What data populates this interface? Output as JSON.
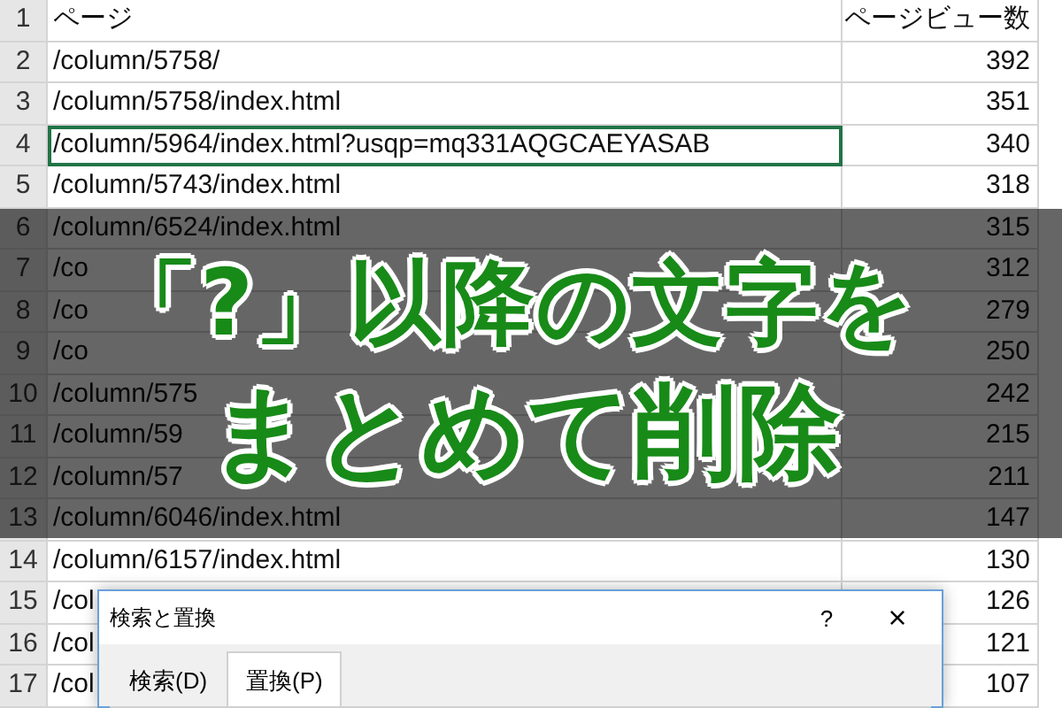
{
  "sheet": {
    "rows": [
      {
        "number": "1",
        "page": "ページ",
        "views": "ページビュー数",
        "selected": false
      },
      {
        "number": "2",
        "page": "/column/5758/",
        "views": "392",
        "selected": false
      },
      {
        "number": "3",
        "page": "/column/5758/index.html",
        "views": "351",
        "selected": false
      },
      {
        "number": "4",
        "page": "/column/5964/index.html?usqp=mq331AQGCAEYASAB",
        "views": "340",
        "selected": true
      },
      {
        "number": "5",
        "page": "/column/5743/index.html",
        "views": "318",
        "selected": false
      },
      {
        "number": "6",
        "page": "/column/6524/index.html",
        "views": "315",
        "selected": false
      },
      {
        "number": "7",
        "page": "/co",
        "views": "312",
        "selected": false
      },
      {
        "number": "8",
        "page": "/co",
        "views": "279",
        "selected": false
      },
      {
        "number": "9",
        "page": "/co",
        "views": "250",
        "selected": false
      },
      {
        "number": "10",
        "page": "/column/575",
        "views": "242",
        "selected": false
      },
      {
        "number": "11",
        "page": "/column/59",
        "views": "215",
        "selected": false
      },
      {
        "number": "12",
        "page": "/column/57",
        "views": "211",
        "selected": false
      },
      {
        "number": "13",
        "page": "/column/6046/index.html",
        "views": "147",
        "selected": false
      },
      {
        "number": "14",
        "page": "/column/6157/index.html",
        "views": "130",
        "selected": false
      },
      {
        "number": "15",
        "page": "/col",
        "views": "126",
        "selected": false
      },
      {
        "number": "16",
        "page": "/col",
        "views": "121",
        "selected": false
      },
      {
        "number": "17",
        "page": "/col",
        "views": "107",
        "selected": false
      }
    ]
  },
  "headline": {
    "lines": [
      "「?」以降の文字を",
      "まとめて削除"
    ]
  },
  "dialog": {
    "title": "検索と置換",
    "help": "?",
    "close": "×",
    "tabs": [
      {
        "label": "検索(D)",
        "selected": false
      },
      {
        "label": "置換(P)",
        "selected": true
      }
    ]
  }
}
